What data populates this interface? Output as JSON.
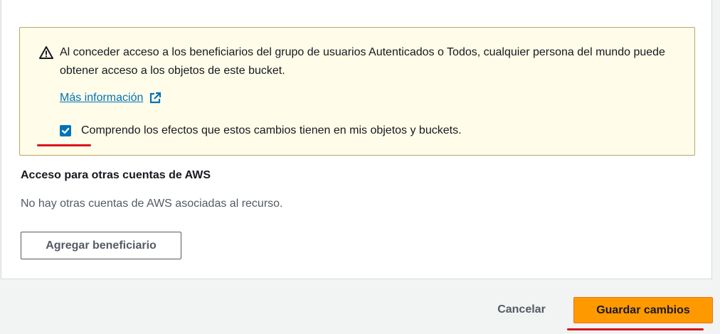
{
  "warning": {
    "message": "Al conceder acceso a los beneficiarios del grupo de usuarios Autenticados o Todos, cualquier persona del mundo puede obtener acceso a los objetos de este bucket.",
    "link_label": "Más información",
    "checkbox_label": "Comprendo los efectos que estos cambios tienen en mis objetos y buckets.",
    "checkbox_checked": true,
    "icon": "warning-triangle-icon",
    "link_icon": "external-link-icon",
    "colors": {
      "background": "#fffce9",
      "border": "#b6a764",
      "link": "#0073bb"
    }
  },
  "other_accounts": {
    "title": "Acceso para otras cuentas de AWS",
    "description": "No hay otras cuentas de AWS asociadas al recurso.",
    "add_button_label": "Agregar beneficiario"
  },
  "footer": {
    "cancel_label": "Cancelar",
    "save_label": "Guardar cambios",
    "save_color": "#ff9900"
  },
  "annotations": {
    "highlight_color": "#d9151b"
  }
}
